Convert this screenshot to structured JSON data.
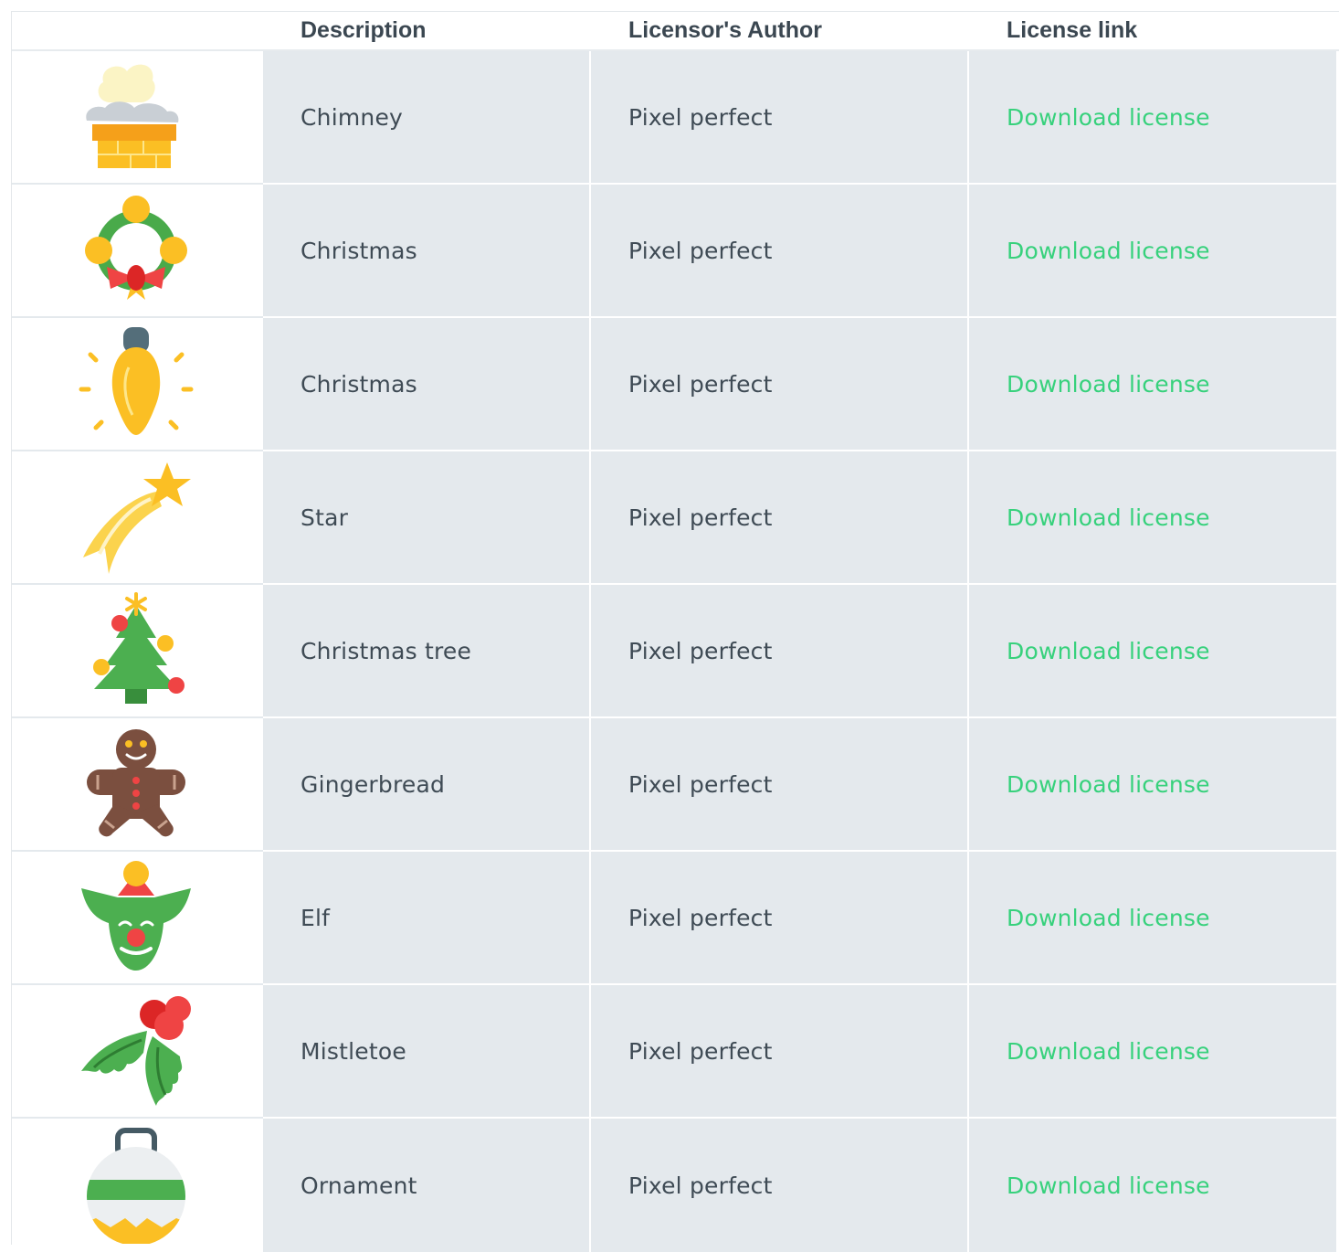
{
  "table": {
    "headers": [
      "",
      "Description",
      "Licensor's Author",
      "License link"
    ],
    "rows": [
      {
        "icon": "chimney-icon",
        "description": "Chimney",
        "author": "Pixel perfect",
        "link": "Download license"
      },
      {
        "icon": "wreath-icon",
        "description": "Christmas",
        "author": "Pixel perfect",
        "link": "Download license"
      },
      {
        "icon": "light-bulb-icon",
        "description": "Christmas",
        "author": "Pixel perfect",
        "link": "Download license"
      },
      {
        "icon": "shooting-star-icon",
        "description": "Star",
        "author": "Pixel perfect",
        "link": "Download license"
      },
      {
        "icon": "christmas-tree-icon",
        "description": "Christmas tree",
        "author": "Pixel perfect",
        "link": "Download license"
      },
      {
        "icon": "gingerbread-icon",
        "description": "Gingerbread",
        "author": "Pixel perfect",
        "link": "Download license"
      },
      {
        "icon": "elf-icon",
        "description": "Elf",
        "author": "Pixel perfect",
        "link": "Download license"
      },
      {
        "icon": "mistletoe-icon",
        "description": "Mistletoe",
        "author": "Pixel perfect",
        "link": "Download license"
      },
      {
        "icon": "ornament-icon",
        "description": "Ornament",
        "author": "Pixel perfect",
        "link": "Download license"
      }
    ]
  },
  "colors": {
    "row_background": "#e4e9ed",
    "link": "#37d17c",
    "text": "#3f4b55"
  }
}
